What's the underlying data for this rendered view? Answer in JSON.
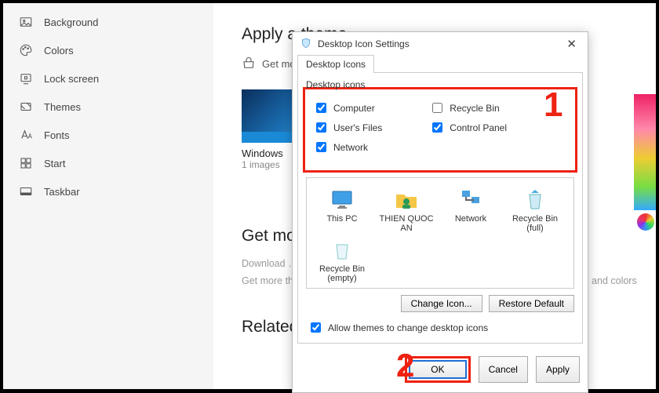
{
  "sidebar": {
    "items": [
      {
        "label": "Background"
      },
      {
        "label": "Colors"
      },
      {
        "label": "Lock screen"
      },
      {
        "label": "Themes"
      },
      {
        "label": "Fonts"
      },
      {
        "label": "Start"
      },
      {
        "label": "Taskbar"
      }
    ]
  },
  "main": {
    "apply_heading": "Apply a theme",
    "get_more_link": "Get more…",
    "theme_name": "Windows",
    "theme_sub": "1 images",
    "get_more_heading": "Get more…",
    "download_line": "Download …",
    "get_more_line": "Get more th…",
    "colors_tail": "unds, and colors",
    "related_heading": "Related Settings"
  },
  "dialog": {
    "title": "Desktop Icon Settings",
    "tab": "Desktop Icons",
    "group": "Desktop icons",
    "checks": {
      "computer": "Computer",
      "users_files": "User's Files",
      "network": "Network",
      "recycle_bin": "Recycle Bin",
      "control_panel": "Control Panel"
    },
    "checked": {
      "computer": true,
      "users_files": true,
      "network": true,
      "recycle_bin": false,
      "control_panel": true
    },
    "icons": [
      "This PC",
      "THIEN QUOC AN",
      "Network",
      "Recycle Bin (full)",
      "Recycle Bin (empty)"
    ],
    "change_icon": "Change Icon...",
    "restore_default": "Restore Default",
    "allow_themes": "Allow themes to change desktop icons",
    "allow_checked": true,
    "ok": "OK",
    "cancel": "Cancel",
    "apply": "Apply"
  },
  "annotations": {
    "n1": "1",
    "n2": "2"
  }
}
